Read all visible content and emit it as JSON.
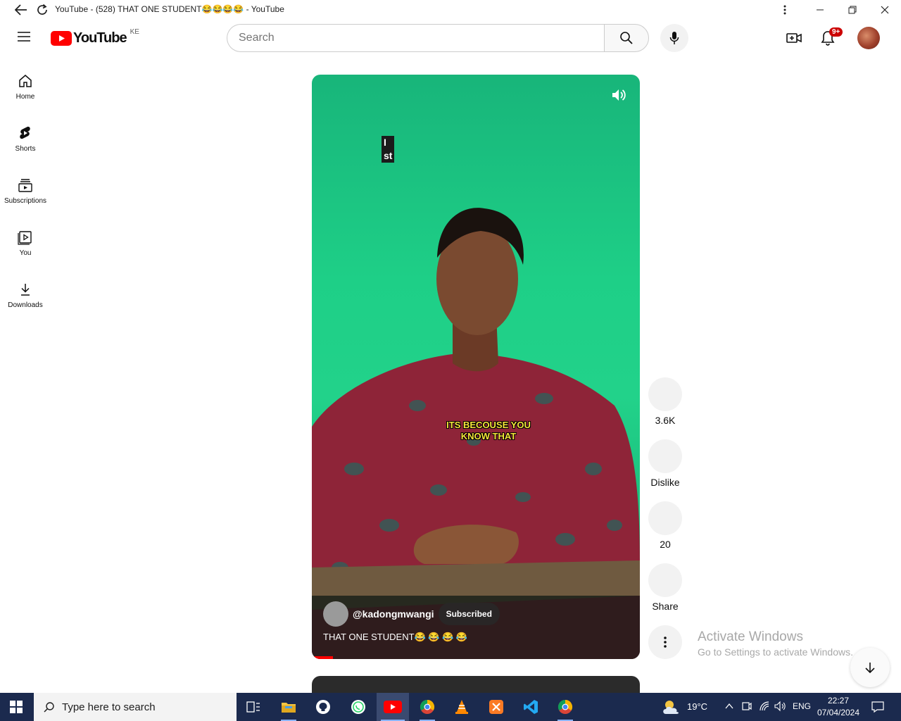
{
  "window": {
    "title": "YouTube - (528) THAT ONE STUDENT😂😂😂😂 - YouTube"
  },
  "header": {
    "logo_text": "YouTube",
    "country_code": "KE",
    "search_placeholder": "Search",
    "notification_count": "9+"
  },
  "sidebar": {
    "items": [
      {
        "label": "Home",
        "icon": "home-icon"
      },
      {
        "label": "Shorts",
        "icon": "shorts-icon"
      },
      {
        "label": "Subscriptions",
        "icon": "subscriptions-icon"
      },
      {
        "label": "You",
        "icon": "you-icon"
      },
      {
        "label": "Downloads",
        "icon": "download-icon"
      }
    ]
  },
  "short": {
    "overlay_text_line1": "I",
    "overlay_text_line2": "st",
    "caption_line1": "ITS BECOUSE YOU",
    "caption_line2": "KNOW THAT",
    "channel": "@kadongmwangi",
    "subscribe_label": "Subscribed",
    "title": "THAT ONE STUDENT😂 😂 😂 😂"
  },
  "actions": {
    "like_count": "3.6K",
    "dislike_label": "Dislike",
    "comments_count": "20",
    "share_label": "Share"
  },
  "watermark": {
    "line1": "Activate Windows",
    "line2": "Go to Settings to activate Windows."
  },
  "taskbar": {
    "search_placeholder": "Type here to search",
    "weather": "19°C",
    "language": "ENG",
    "time": "22:27",
    "date": "07/04/2024"
  },
  "colors": {
    "youtube_red": "#ff0000",
    "green_screen": "#1ecf87",
    "sweater": "#8e2438",
    "taskbar": "#1b2a4e"
  }
}
